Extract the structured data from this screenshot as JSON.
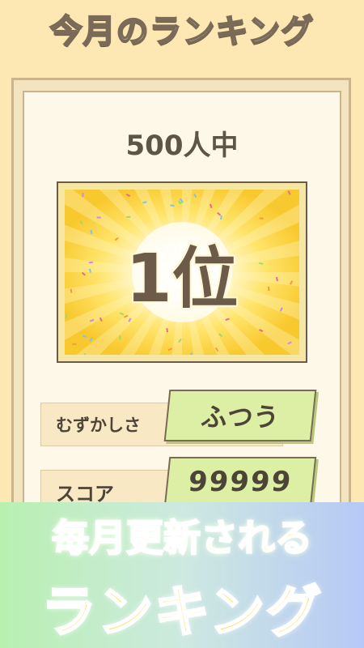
{
  "header": {
    "title": "今月のランキング"
  },
  "summary": {
    "count_label": "500人中"
  },
  "rank": {
    "label": "1位"
  },
  "rows": [
    {
      "label": "むずかしさ",
      "value": "ふつう"
    },
    {
      "label": "スコア",
      "value": "99999"
    }
  ],
  "banner": {
    "line1": "毎月更新される",
    "line2": "ランキング"
  },
  "colors": {
    "background": "#fde7b3",
    "panel": "#fdf8e8",
    "value_box": "#dcefa4",
    "banner_text_top": "#f7ff7a",
    "banner_text_bottom": "#ffd94a"
  }
}
